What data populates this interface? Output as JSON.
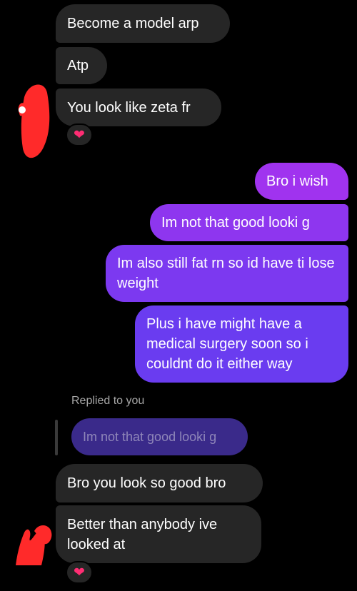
{
  "messages": {
    "m1": "Become a model arp",
    "m2": "Atp",
    "m3": "You look like zeta fr",
    "m4": "Bro i wish",
    "m5": "Im not that good looki g",
    "m6": "Im also still fat rn so id have ti lose weight",
    "m7": "Plus i have might have a medical surgery soon so i couldnt do it either way",
    "m8": "Bro you look so good bro",
    "m9": "Better than anybody ive looked at"
  },
  "reply": {
    "label": "Replied to you",
    "quoted": "Im not that good looki g"
  },
  "reactions": {
    "r1": "❤",
    "r2": "❤"
  },
  "icons": {
    "heart": "heart-icon",
    "avatar": "redacted-avatar-scribble"
  },
  "colors": {
    "background": "#000000",
    "incoming_bubble": "#262626",
    "outgoing_gradient_top": "#a033ef",
    "outgoing_gradient_bottom": "#6a3cf0",
    "quoted_bubble": "#3a2a8a",
    "heart": "#ff2d73",
    "scribble": "#ff2a2a"
  }
}
